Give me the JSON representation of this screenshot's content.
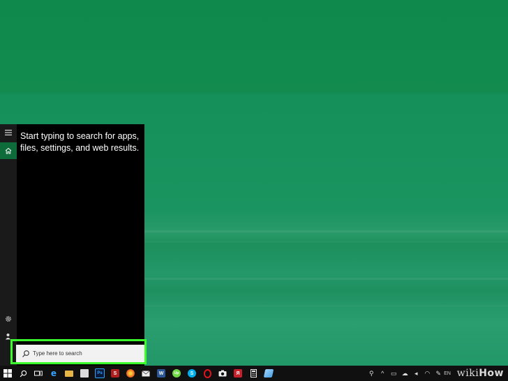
{
  "start_menu": {
    "hint_text": "Start typing to search for apps, files, settings, and web results.",
    "rail": {
      "menu_icon": "hamburger-icon",
      "home_icon": "home-icon",
      "settings_icon": "gear-icon",
      "account_icon": "person-icon"
    }
  },
  "search": {
    "placeholder": "Type here to search",
    "icon": "search-icon",
    "highlight_color": "#3aff2a"
  },
  "taskbar": {
    "icons": [
      "windows-start-icon",
      "search-icon",
      "task-view-icon",
      "edge-icon",
      "file-explorer-icon",
      "store-icon",
      "photoshop-icon",
      "app-s-icon",
      "firefox-icon",
      "mail-icon",
      "word-icon",
      "upwork-icon",
      "skype-icon",
      "opera-icon",
      "camera-icon",
      "yandex-icon",
      "calculator-icon",
      "paint-icon"
    ],
    "tray_lang": "EN"
  },
  "watermark": {
    "prefix": "wiki",
    "suffix": "How"
  },
  "colors": {
    "desktop": "#17904f",
    "taskbar": "#101010",
    "panel": "#000000"
  }
}
